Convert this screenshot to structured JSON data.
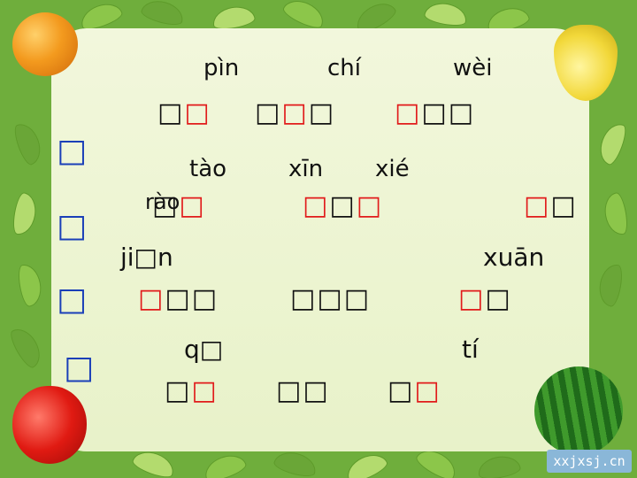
{
  "pinyin": {
    "row1": [
      "pìn",
      "chí",
      "wèi"
    ],
    "row2": [
      "tào",
      "xīn",
      "xié"
    ],
    "row2b": "rào",
    "row3": [
      "ji□n",
      "xuān"
    ],
    "row4": [
      "q□",
      "tí"
    ]
  },
  "side_title": [
    "□",
    "□",
    "□",
    "□"
  ],
  "word_groups": {
    "row1": [
      {
        "black": "□",
        "red": "□"
      },
      {
        "black1": "□",
        "red": "□",
        "black2": "□"
      },
      {
        "red": "□",
        "black": "□□"
      }
    ],
    "row2": [
      {
        "black": "□",
        "red": "□"
      },
      {
        "red1": "□",
        "black": "□",
        "red2": "□"
      },
      {
        "red": "□",
        "black": "□"
      }
    ],
    "row3": [
      {
        "red": "□",
        "black": "□□"
      },
      {
        "black": "□□□"
      },
      {
        "red": "□",
        "black": "□"
      }
    ],
    "row4": [
      {
        "black": "□",
        "red": "□"
      },
      {
        "black": "□□"
      },
      {
        "black": "□",
        "red": "□"
      }
    ]
  },
  "logo_text": "xxjxsj.cn",
  "colors": {
    "highlight": "#e11b1b",
    "side": "#1a3fb8",
    "frame": "#6fae3c"
  },
  "icons": [
    "orange-icon",
    "pear-icon",
    "apple-icon",
    "watermelon-icon"
  ]
}
